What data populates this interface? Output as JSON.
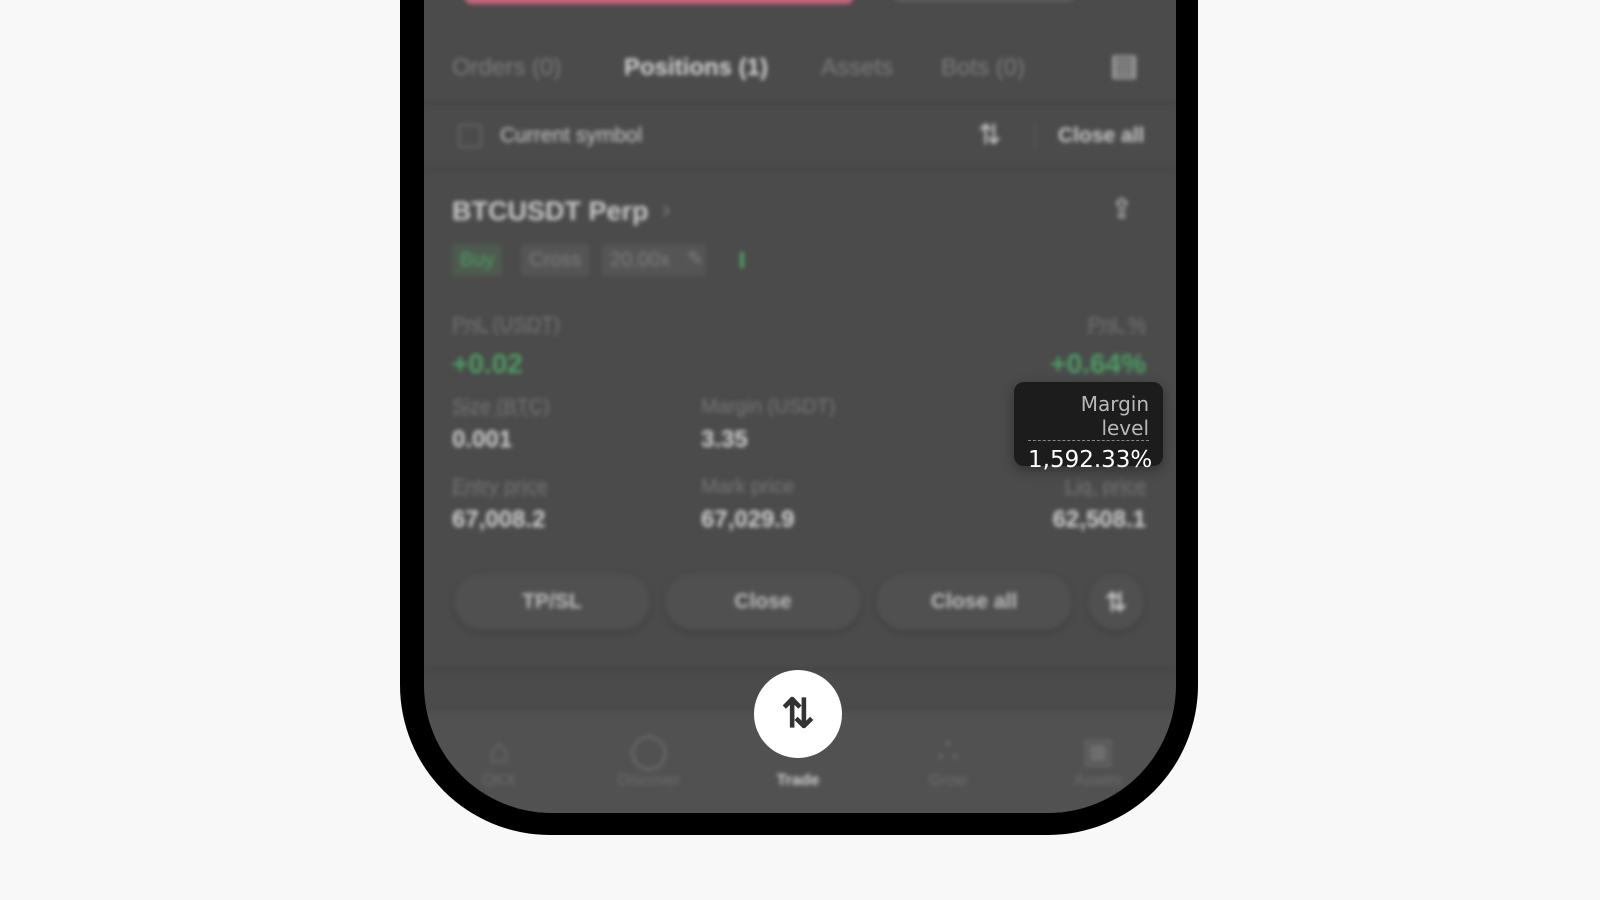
{
  "tabs": [
    {
      "label": "Orders (0)"
    },
    {
      "label": "Positions (1)",
      "active": true
    },
    {
      "label": "Assets"
    },
    {
      "label": "Bots (0)"
    }
  ],
  "filter": {
    "checkbox_label": "Current symbol",
    "close_all": "Close all"
  },
  "position": {
    "symbol": "BTCUSDT Perp",
    "tags": [
      "Buy",
      "Cross",
      "20.00x"
    ],
    "pnl_label": "PnL (USDT)",
    "pnl_value": "+0.02",
    "pnl_pct_label": "PnL %",
    "pnl_pct_value": "+0.64%",
    "size_label": "Size (BTC)",
    "size_value": "0.001",
    "margin_label": "Margin (USDT)",
    "margin_value": "3.35",
    "entry_label": "Entry price",
    "entry_value": "67,008.2",
    "mark_label": "Mark price",
    "mark_value": "67,029.9",
    "liq_label": "Liq. price",
    "liq_value": "62,508.1"
  },
  "actions": {
    "tpsl": "TP/SL",
    "close": "Close",
    "close_all": "Close all"
  },
  "tooltip": {
    "label": "Margin level",
    "value": "1,592.33%"
  },
  "nav": [
    {
      "label": "OKX",
      "icon": "home-icon"
    },
    {
      "label": "Discover",
      "icon": "discover-icon"
    },
    {
      "label": "Trade",
      "icon": "trade-icon",
      "active": true
    },
    {
      "label": "Grow",
      "icon": "grow-icon"
    },
    {
      "label": "Assets",
      "icon": "wallet-icon"
    }
  ],
  "colors": {
    "positive": "#4c9e63",
    "accent_bar": "#c9657c"
  }
}
